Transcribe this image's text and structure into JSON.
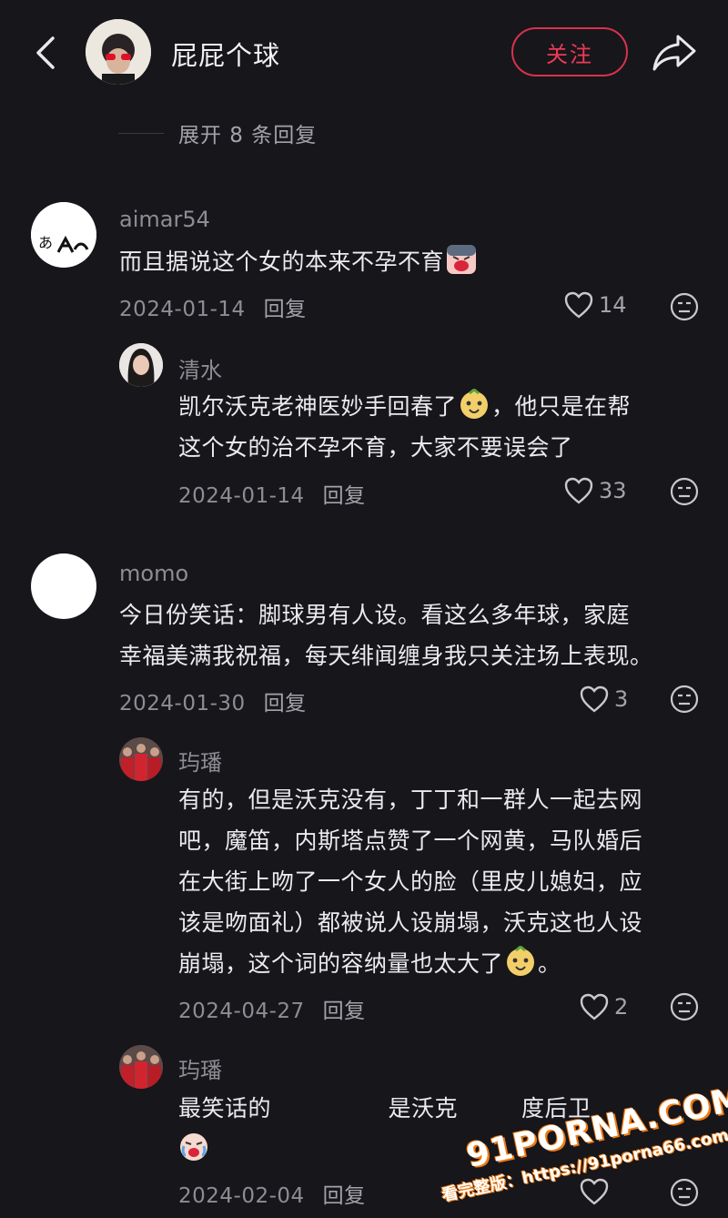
{
  "header": {
    "username": "屁屁个球",
    "follow_label": "关注"
  },
  "thread": {
    "expand_text": "展开 8 条回复"
  },
  "comments": [
    {
      "username": "aimar54",
      "text": "而且据说这个女的本来不孕不育",
      "date": "2024-01-14",
      "reply_label": "回复",
      "likes": "14",
      "replies": [
        {
          "username": "清水",
          "text_line1": "凯尔沃克老神医妙手回春了",
          "text_line1b": "，他只是在帮",
          "text_line2": "这个女的治不孕不育，大家不要误会了",
          "date": "2024-01-14",
          "reply_label": "回复",
          "likes": "33"
        }
      ]
    },
    {
      "username": "momo",
      "text_line1": "今日份笑话：脚球男有人设。看这么多年球，家庭",
      "text_line2": "幸福美满我祝福，每天绯闻缠身我只关注场上表现。",
      "date": "2024-01-30",
      "reply_label": "回复",
      "likes": "3",
      "replies": [
        {
          "username": "玙璠",
          "lines": [
            "有的，但是沃克没有，丁丁和一群人一起去网",
            "吧，魔笛，内斯塔点赞了一个网黄，马队婚后",
            "在大街上吻了一个女人的脸（里皮儿媳妇，应",
            "该是吻面礼）都被说人设崩塌，沃克这也人设",
            "崩塌，这个词的容纳量也太大了"
          ],
          "line_end": "。",
          "date": "2024-04-27",
          "reply_label": "回复",
          "likes": "2"
        },
        {
          "username": "玙璠",
          "text_a": "最笑话的",
          "text_b": "是沃克",
          "text_c": "度后卫",
          "date": "2024-02-04",
          "reply_label": "回复",
          "likes": ""
        }
      ]
    }
  ],
  "watermark": {
    "logo": "91PORNA.COM",
    "url": "看完整版：https://91porna66.com"
  },
  "colors": {
    "background": "#17161b",
    "accent": "#ee3a56",
    "secondary_text": "#8e8d93"
  },
  "icons": [
    "back-chevron-icon",
    "share-arrow-icon",
    "heart-icon",
    "dislike-face-icon",
    "smile-emoji-icon",
    "crying-emoji-icon"
  ]
}
